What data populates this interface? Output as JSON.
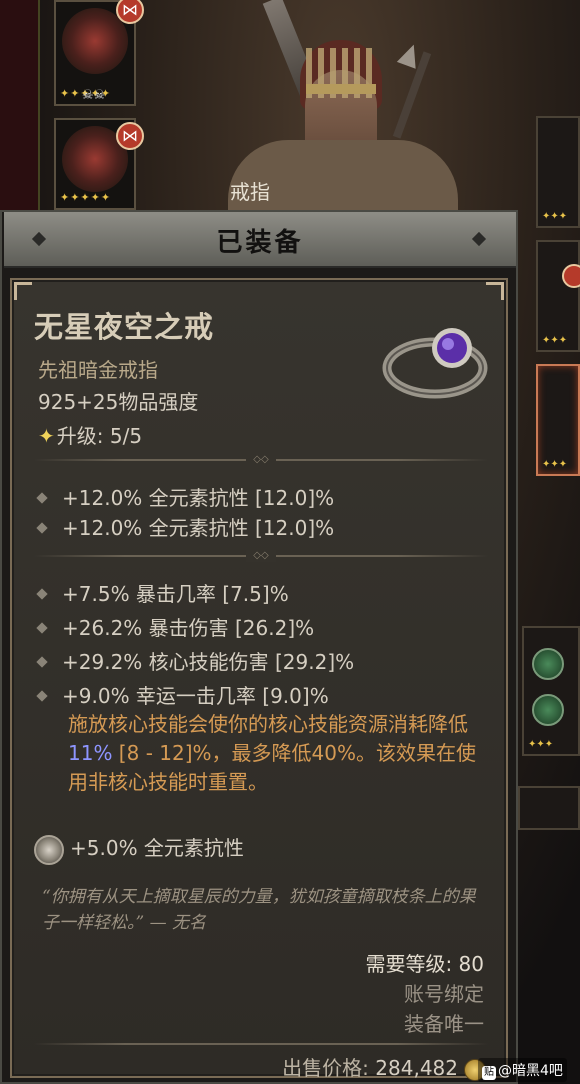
{
  "slot_label": "戒指",
  "panel": {
    "title": "已装备"
  },
  "item": {
    "name": "无星夜空之戒",
    "type": "先祖暗金戒指",
    "power": "925+25物品强度",
    "upgrade_label": "升级: 5/5",
    "implicits": [
      "+12.0% 全元素抗性 [12.0]%",
      "+12.0% 全元素抗性 [12.0]%"
    ],
    "affixes": [
      "+7.5% 暴击几率 [7.5]%",
      "+26.2% 暴击伤害 [26.2]%",
      "+29.2% 核心技能伤害 [29.2]%",
      "+9.0% 幸运一击几率 [9.0]%"
    ],
    "unique_power": {
      "before": "施放核心技能会使你的核心技能资源消耗降低 ",
      "value": "11%",
      "after": " [8 - 12]%，最多降低40%。该效果在使用非核心技能时重置。"
    },
    "socket_affix": "+5.0% 全元素抗性",
    "flavor": "“你拥有从天上摘取星辰的力量，犹如孩童摘取枝条上的果子一样轻松。” — 无名",
    "required_level": "需要等级: 80",
    "bound": "账号绑定",
    "equip_unique": "装备唯一",
    "sell_label": "出售价格:",
    "sell_value": "284,482"
  },
  "icons": {
    "upgrade": "diamond-star-icon",
    "ring": "ring-icon",
    "gold": "gold-coin-icon",
    "socket": "gem-socket-icon"
  },
  "colors": {
    "unique_power": "#d59a54",
    "highlight_value": "#8e95ff",
    "item_name": "#d7cdb8",
    "item_type": "#b9a98a"
  },
  "watermark": {
    "text": "@暗黑4吧",
    "logo": "贴"
  }
}
